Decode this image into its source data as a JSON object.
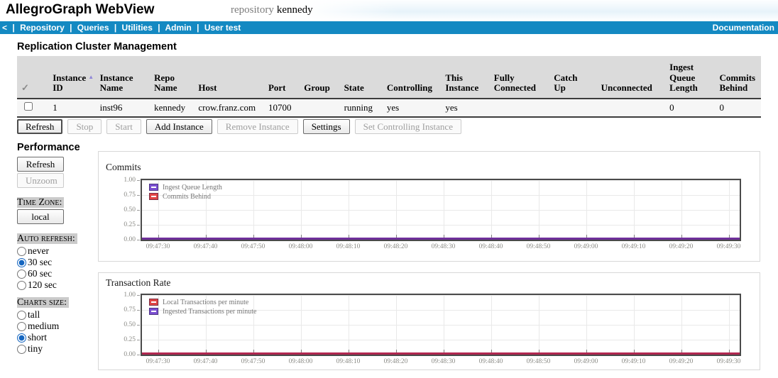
{
  "header": {
    "app_title": "AllegroGraph WebView",
    "repository_label": "repository",
    "repository_name": "kennedy"
  },
  "nav": {
    "back_label": "<",
    "separator": "|",
    "items": [
      "Repository",
      "Queries",
      "Utilities",
      "Admin",
      "User test"
    ],
    "right_label": "Documentation",
    "bar_color": "#1489c2"
  },
  "cluster": {
    "heading": "Replication Cluster Management",
    "table": {
      "check_glyph": "✓",
      "sort_indicator": "▲",
      "columns": [
        {
          "lines": [
            "Instance",
            "ID"
          ],
          "sorted": "ascending"
        },
        {
          "lines": [
            "Instance",
            "Name"
          ]
        },
        {
          "lines": [
            "Repo",
            "Name"
          ]
        },
        {
          "lines": [
            "Host"
          ]
        },
        {
          "lines": [
            "Port"
          ]
        },
        {
          "lines": [
            "Group"
          ]
        },
        {
          "lines": [
            "State"
          ]
        },
        {
          "lines": [
            "Controlling"
          ]
        },
        {
          "lines": [
            "This",
            "Instance"
          ]
        },
        {
          "lines": [
            "Fully",
            "Connected"
          ]
        },
        {
          "lines": [
            "Catch",
            "Up"
          ]
        },
        {
          "lines": [
            "Unconnected"
          ]
        },
        {
          "lines": [
            "Ingest",
            "Queue",
            "Length"
          ]
        },
        {
          "lines": [
            "Commits",
            "Behind"
          ]
        }
      ],
      "row": {
        "checked": false,
        "cells": [
          "1",
          "inst96",
          "kennedy",
          "crow.franz.com",
          "10700",
          "",
          "running",
          "yes",
          "yes",
          "",
          "",
          "",
          "0",
          "0"
        ]
      }
    },
    "buttons": [
      {
        "label": "Refresh",
        "enabled": true
      },
      {
        "label": "Stop",
        "enabled": false
      },
      {
        "label": "Start",
        "enabled": false
      },
      {
        "label": "Add Instance",
        "enabled": true
      },
      {
        "label": "Remove Instance",
        "enabled": false
      },
      {
        "label": "Settings",
        "enabled": true
      },
      {
        "label": "Set Controlling Instance",
        "enabled": false
      }
    ]
  },
  "performance": {
    "heading": "Performance",
    "refresh_button": "Refresh",
    "unzoom_button": "Unzoom",
    "time_zone_label": "Time Zone:",
    "time_zone_button": "local",
    "auto_refresh_label": "Auto refresh:",
    "auto_refresh_options": [
      {
        "label": "never",
        "selected": false
      },
      {
        "label": "30 sec",
        "selected": true
      },
      {
        "label": "60 sec",
        "selected": false
      },
      {
        "label": "120 sec",
        "selected": false
      }
    ],
    "charts_size_label": "Charts size:",
    "charts_size_options": [
      {
        "label": "tall",
        "selected": false
      },
      {
        "label": "medium",
        "selected": false
      },
      {
        "label": "short",
        "selected": true
      },
      {
        "label": "tiny",
        "selected": false
      }
    ]
  },
  "chart_data": [
    {
      "type": "line",
      "title": "Commits",
      "x": [
        "09:47:30",
        "09:47:40",
        "09:47:50",
        "09:48:00",
        "09:48:10",
        "09:48:20",
        "09:48:30",
        "09:48:40",
        "09:48:50",
        "09:49:00",
        "09:49:10",
        "09:49:20",
        "09:49:30"
      ],
      "yticks": [
        "1.00",
        "0.75",
        "0.50",
        "0.25",
        "0.00"
      ],
      "ylim": [
        0,
        1
      ],
      "grid": true,
      "legend_position": "top-left",
      "series": [
        {
          "name": "Ingest Queue Length",
          "color": "#7a4fd0",
          "values": [
            0,
            0,
            0,
            0,
            0,
            0,
            0,
            0,
            0,
            0,
            0,
            0,
            0
          ]
        },
        {
          "name": "Commits Behind",
          "color": "#e04545",
          "values": [
            0,
            0,
            0,
            0,
            0,
            0,
            0,
            0,
            0,
            0,
            0,
            0,
            0
          ]
        }
      ],
      "line_color": "#6f2f9b"
    },
    {
      "type": "line",
      "title": "Transaction Rate",
      "x": [
        "09:47:30",
        "09:47:40",
        "09:47:50",
        "09:48:00",
        "09:48:10",
        "09:48:20",
        "09:48:30",
        "09:48:40",
        "09:48:50",
        "09:49:00",
        "09:49:10",
        "09:49:20",
        "09:49:30"
      ],
      "yticks": [
        "1.00",
        "0.75",
        "0.50",
        "0.25",
        "0.00"
      ],
      "ylim": [
        0,
        1
      ],
      "grid": true,
      "legend_position": "top-left",
      "series": [
        {
          "name": "Local Transactions per minute",
          "color": "#e04545",
          "values": [
            0,
            0,
            0,
            0,
            0,
            0,
            0,
            0,
            0,
            0,
            0,
            0,
            0
          ]
        },
        {
          "name": "Ingested Transactions per minute",
          "color": "#7a4fd0",
          "values": [
            0,
            0,
            0,
            0,
            0,
            0,
            0,
            0,
            0,
            0,
            0,
            0,
            0
          ]
        }
      ],
      "line_color": "#b12750"
    }
  ]
}
